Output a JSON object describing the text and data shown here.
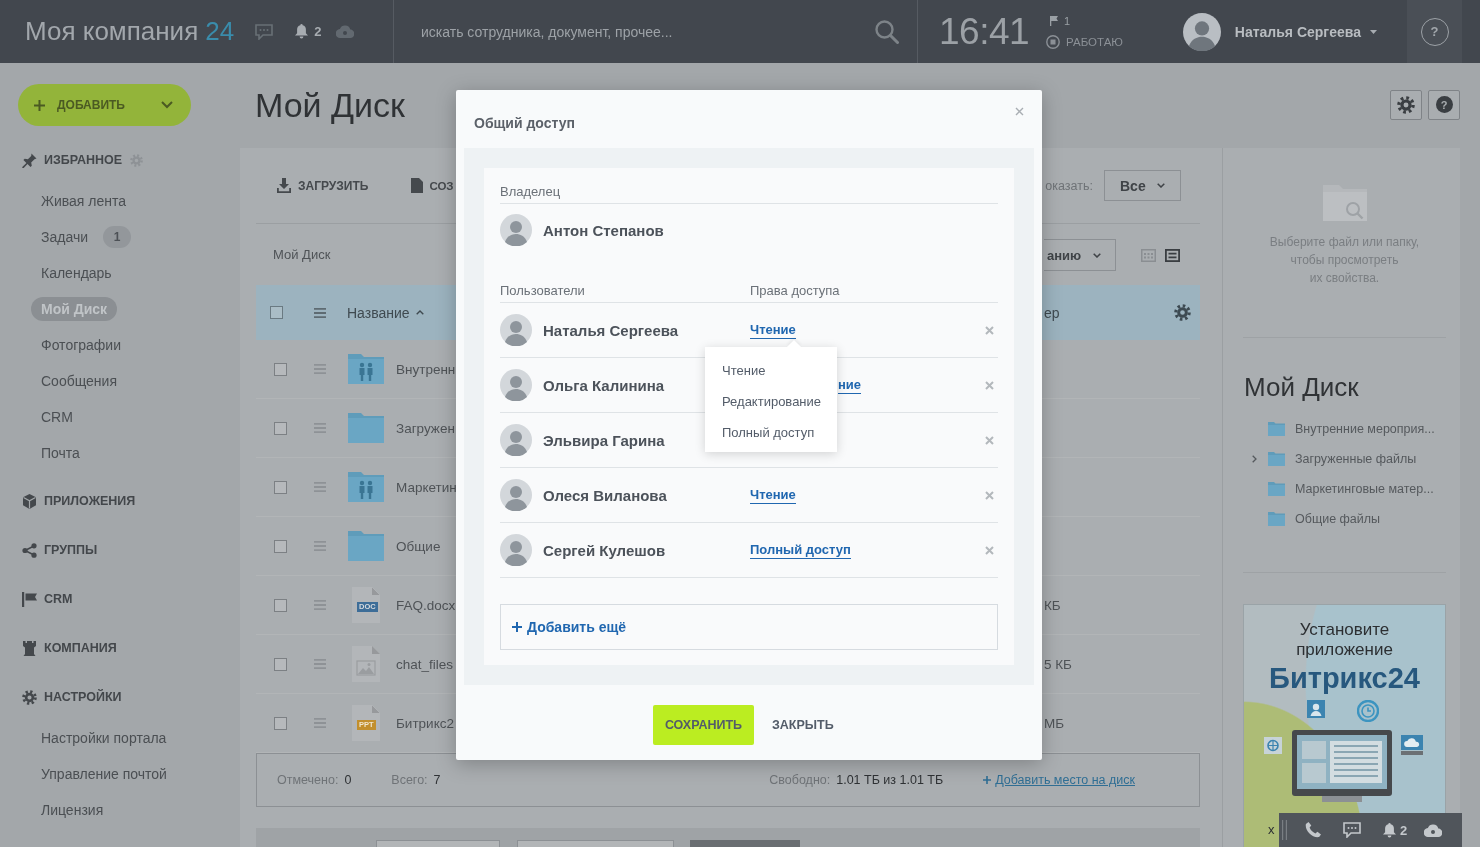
{
  "topbar": {
    "logo": {
      "name": "Моя компания",
      "number": "24"
    },
    "notifications": "2",
    "search": {
      "placeholder": "искать сотрудника, документ, прочее..."
    },
    "clock": "16:41",
    "flags": "1",
    "work_status": "РАБОТАЮ",
    "user": {
      "name": "Наталья Сергеева"
    },
    "help": "?"
  },
  "sidebar": {
    "add_button": "ДОБАВИТЬ",
    "sections": [
      {
        "title": "ИЗБРАННОЕ",
        "settings_icon": true,
        "items": [
          {
            "label": "Живая лента",
            "selected": false
          },
          {
            "label": "Задачи",
            "counter": "1",
            "selected": false
          },
          {
            "label": "Календарь",
            "selected": false
          },
          {
            "label": "Мой Диск",
            "selected": true
          },
          {
            "label": "Фотографии",
            "selected": false
          },
          {
            "label": "Сообщения",
            "selected": false
          },
          {
            "label": "CRM",
            "selected": false
          },
          {
            "label": "Почта",
            "selected": false
          }
        ]
      },
      {
        "title": "ПРИЛОЖЕНИЯ",
        "settings_icon": false
      },
      {
        "title": "ГРУППЫ",
        "settings_icon": false
      },
      {
        "title": "CRM",
        "settings_icon": false
      },
      {
        "title": "КОМПАНИЯ",
        "settings_icon": false
      },
      {
        "title": "НАСТРОЙКИ",
        "settings_icon": false,
        "items": [
          {
            "label": "Настройки портала",
            "selected": false
          },
          {
            "label": "Управление почтой",
            "selected": false
          },
          {
            "label": "Лицензия",
            "selected": false
          }
        ]
      }
    ]
  },
  "page": {
    "title": "Мой Диск",
    "help": "?"
  },
  "toolbar": {
    "upload": "ЗАГРУЗИТЬ",
    "create": "СОЗ",
    "show_label": "оказать:",
    "filter": "Все",
    "sort": "анию",
    "views": [
      {
        "kind": "grid",
        "selected": false
      },
      {
        "kind": "list",
        "selected": true
      }
    ]
  },
  "breadcrumb": "Мой Диск",
  "table": {
    "select_all": {
      "checked": false
    },
    "columns": [
      {
        "label": "Название",
        "sorted": true
      },
      {
        "label": "ер",
        "sorted": false
      }
    ],
    "rows": [
      {
        "kind": "shared-folder",
        "name": "Внутренн",
        "checked": false
      },
      {
        "kind": "folder",
        "name": "Загружен",
        "checked": false
      },
      {
        "kind": "shared-folder",
        "name": "Маркетин",
        "checked": false
      },
      {
        "kind": "folder",
        "name": "Общие",
        "checked": false
      },
      {
        "kind": "doc",
        "badge": "DOC",
        "name": "FAQ.docx",
        "size": "КБ",
        "checked": false
      },
      {
        "kind": "image",
        "name": "chat_files",
        "size": "5 КБ",
        "checked": false
      },
      {
        "kind": "ppt",
        "badge": "PPT",
        "name": "Битрикс2",
        "size": "МБ",
        "checked": false
      }
    ]
  },
  "summary": {
    "selected_label": "Отмечено:",
    "selected_count": "0",
    "total_label": "Всего:",
    "total_count": "7",
    "free_label": "Свободно:",
    "free_value": "1.01 ТБ из 1.01 ТБ",
    "add_space_link": "Добавить место на диск"
  },
  "details": {
    "hint": [
      "Выберите файл или папку,",
      "чтобы просмотреть",
      "их свойства."
    ],
    "tree_title": "Мой Диск",
    "tree": [
      {
        "label": "Внутренние мероприя...",
        "has_children": false
      },
      {
        "label": "Загруженные файлы",
        "has_children": true
      },
      {
        "label": "Маркетинговые матер...",
        "has_children": false
      },
      {
        "label": "Общие файлы",
        "has_children": false
      }
    ]
  },
  "banner": {
    "headline": "Установите приложение",
    "brand": "Битрикс24",
    "cut_text": "х"
  },
  "dock": {
    "notifications": "2"
  },
  "modal": {
    "title": "Общий доступ",
    "owner_label": "Владелец",
    "owner": {
      "name": "Антон Степанов"
    },
    "users_label": "Пользователи",
    "rights_label": "Права доступа",
    "users": [
      {
        "name": "Наталья Сергеева",
        "access": "Чтение"
      },
      {
        "name": "Ольга Калинина",
        "access_partial": "ние"
      },
      {
        "name": "Эльвира Гарина"
      },
      {
        "name": "Олеся Виланова",
        "access": "Чтение"
      },
      {
        "name": "Сергей Кулешов",
        "access": "Полный доступ"
      }
    ],
    "access_menu": [
      "Чтение",
      "Редактирование",
      "Полный доступ"
    ],
    "add_more": "Добавить ещё",
    "buttons": [
      {
        "label": "СОХРАНИТЬ",
        "kind": "primary"
      },
      {
        "label": "ЗАКРЫТЬ",
        "kind": "link"
      }
    ]
  }
}
